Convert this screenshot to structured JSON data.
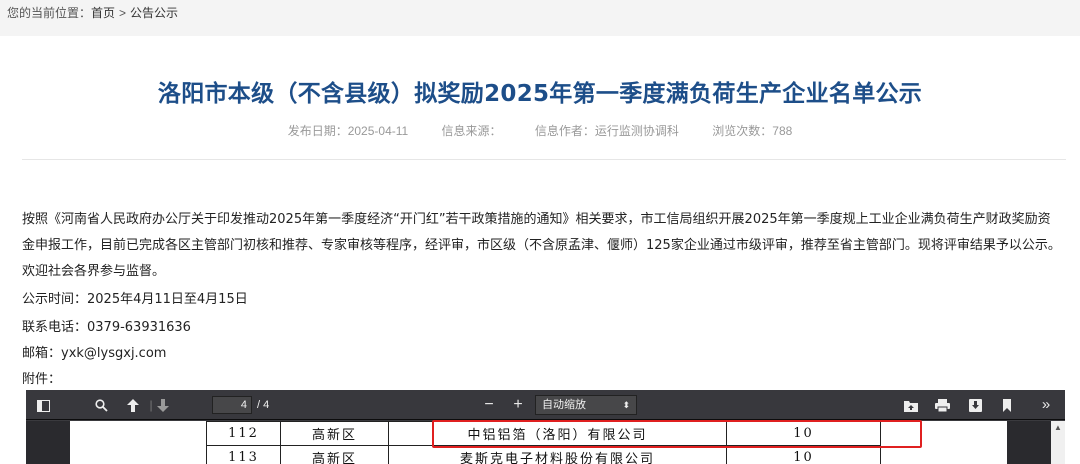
{
  "breadcrumb": {
    "prefix": "您的当前位置：",
    "home": "首页",
    "separator": ">",
    "current": "公告公示"
  },
  "article": {
    "title": "洛阳市本级（不含县级）拟奖励2025年第一季度满负荷生产企业名单公示",
    "publish_date": "发布日期：2025-04-11",
    "source": "信息来源：",
    "author": "信息作者：运行监测协调科",
    "views": "浏览次数：788",
    "paragraph": "按照《河南省人民政府办公厅关于印发推动2025年第一季度经济“开门红”若干政策措施的通知》相关要求，市工信局组织开展2025年第一季度规上工业企业满负荷生产财政奖励资金申报工作，目前已完成各区主管部门初核和推荐、专家审核等程序，经评审，市区级（不含原孟津、偃师）125家企业通过市级评审，推荐至省主管部门。现将评审结果予以公示。欢迎社会各界参与监督。",
    "period": "公示时间：2025年4月11日至4月15日",
    "phone": "联系电话：0379-63931636",
    "email": "邮箱：yxk@lysgxj.com",
    "attachment": "附件："
  },
  "pdf_viewer": {
    "page_current": "4",
    "page_total": "/ 4",
    "zoom_minus": "−",
    "zoom_plus": "+",
    "zoom_value": "自动缩放",
    "zoom_arrow": "⬍",
    "icons": [
      "sidebar-toggle-icon",
      "search-icon",
      "prev-page-icon",
      "next-page-icon",
      "open-file-icon",
      "print-icon",
      "download-icon",
      "bookmark-icon",
      "more-tools-icon"
    ],
    "table_rows": [
      {
        "no": "112",
        "district": "高新区",
        "company": "中铝铝箔（洛阳）有限公司",
        "score": "10"
      },
      {
        "no": "113",
        "district": "高新区",
        "company": "麦斯克电子材料股份有限公司",
        "score": "10"
      }
    ]
  },
  "colors": {
    "title": "#1d4e89",
    "highlight": "#e02020",
    "toolbar": "#38383d"
  }
}
